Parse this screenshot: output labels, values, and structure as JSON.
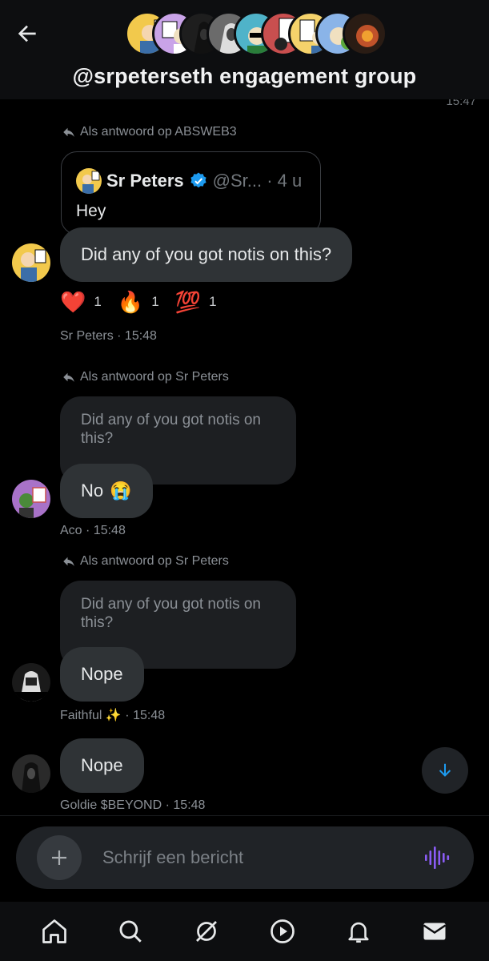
{
  "header": {
    "title": "@srpeterseth engagement group",
    "member_avatars": [
      "#f2c94c",
      "#c9a3e8",
      "#2b2b2b",
      "#888888",
      "#4fb3c9",
      "#c94f4f",
      "#f5d36b",
      "#8bc34a",
      "#3a2a20"
    ]
  },
  "previous_time": "15:47",
  "messages": [
    {
      "reply_label": "Als antwoord op ABSWEB3",
      "quote": {
        "name": "Sr Peters",
        "handle_meta": "@Sr... · 4 u",
        "text": "Hey"
      },
      "text": "Did any of you got notis on this?",
      "reactions": [
        {
          "emoji": "❤️",
          "count": "1"
        },
        {
          "emoji": "🔥",
          "count": "1"
        },
        {
          "emoji": "💯",
          "count": "1"
        }
      ],
      "author": "Sr Peters",
      "time": "· 15:48"
    },
    {
      "reply_label": "Als antwoord op Sr Peters",
      "quoted_text": "Did any of you got notis on this?",
      "text": "No",
      "text_emoji": "😭",
      "author": "Aco",
      "time": "· 15:48"
    },
    {
      "reply_label": "Als antwoord op Sr Peters",
      "quoted_text": "Did any of you got notis on this?",
      "text": "Nope",
      "author": "Faithful ✨",
      "time": "· 15:48"
    },
    {
      "text": "Nope",
      "author": "Goldie $BEYOND",
      "time": "· 15:48"
    }
  ],
  "composer": {
    "placeholder": "Schrijf een bericht"
  },
  "colors": {
    "accent": "#1d9bf0",
    "voice": "#8b5cf6",
    "bubble": "#2f3336"
  }
}
